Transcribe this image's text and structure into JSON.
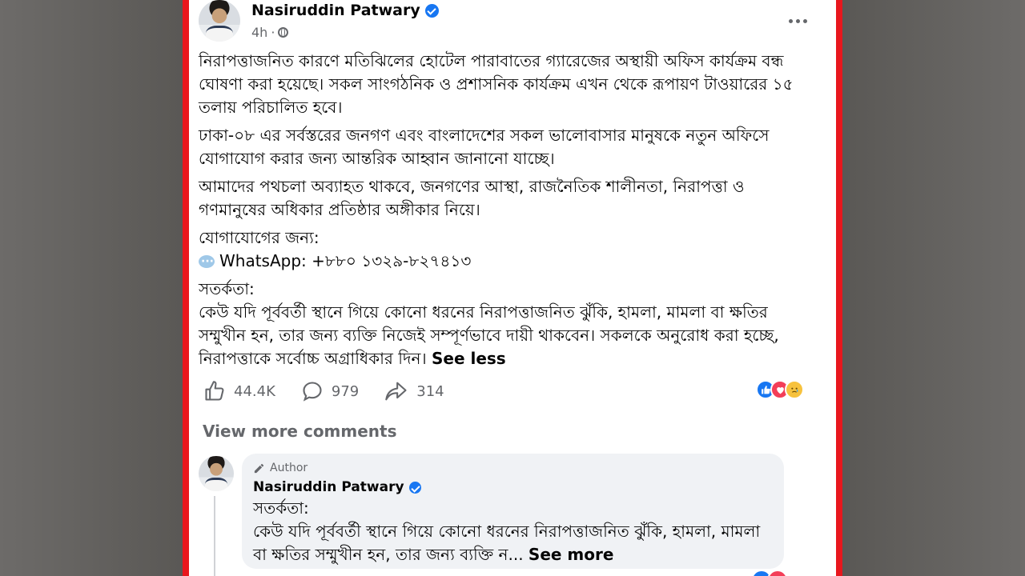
{
  "post": {
    "author": "Nasiruddin Patwary",
    "time": "4h",
    "time_separator": "·",
    "paragraphs": [
      "নিরাপত্তাজনিত কারণে মতিঝিলের হোটেল পারাবাতের গ্যারেজের অস্থায়ী অফিস কার্যক্রম বন্ধ ঘোষণা করা হয়েছে। সকল সাংগঠনিক ও প্রশাসনিক কার্যক্রম এখন থেকে রূপায়ণ টাওয়ারের ১৫ তলায় পরিচালিত হবে।",
      "ঢাকা-০৮ এর সর্বস্তরের জনগণ এবং বাংলাদেশের সকল ভালোবাসার মানুষকে নতুন অফিসে যোগাযোগ করার জন্য আন্তরিক আহ্বান জানানো যাচ্ছে।",
      "আমাদের পথচলা অব্যাহত থাকবে, জনগণের আস্থা, রাজনৈতিক শালীনতা, নিরাপত্তা ও গণমানুষের অধিকার প্রতিষ্ঠার অঙ্গীকার নিয়ে।"
    ],
    "contact_heading": "যোগাযোগের জন্য:",
    "whatsapp": "WhatsApp: +৮৮০ ১৩২৯-৮২৭৪১৩",
    "caution_heading": "সতর্কতা:",
    "caution_text": "কেউ যদি পূর্ববর্তী স্থানে গিয়ে কোনো ধরনের নিরাপত্তাজনিত ঝুঁকি, হামলা, মামলা বা ক্ষতির সম্মুখীন হন, তার জন্য ব্যক্তি নিজেই সম্পূর্ণভাবে দায়ী থাকবেন। সকলকে অনুরোধ করা হচ্ছে, নিরাপত্তাকে সর্বোচ্চ অগ্রাধিকার দিন।",
    "see_less": "See less"
  },
  "actions": {
    "likes": "44.4K",
    "comments": "979",
    "shares": "314"
  },
  "icons": [
    "like-icon",
    "comment-icon",
    "share-icon",
    "globe-icon",
    "more-icon",
    "verified-icon",
    "pencil-icon"
  ],
  "colors": {
    "frame": "#e8171d",
    "accent": "#1877f2",
    "love": "#f33e58"
  },
  "view_more": "View more comments",
  "comment": {
    "tag": "Author",
    "author": "Nasiruddin Patwary",
    "heading": "সতর্কতা:",
    "text": "কেউ যদি পূর্ববর্তী স্থানে গিয়ে কোনো ধরনের নিরাপত্তাজনিত ঝুঁকি, হামলা, মামলা বা ক্ষতির সম্মুখীন হন, তার জন্য ব্যক্তি ন...",
    "see_more": "See more"
  }
}
